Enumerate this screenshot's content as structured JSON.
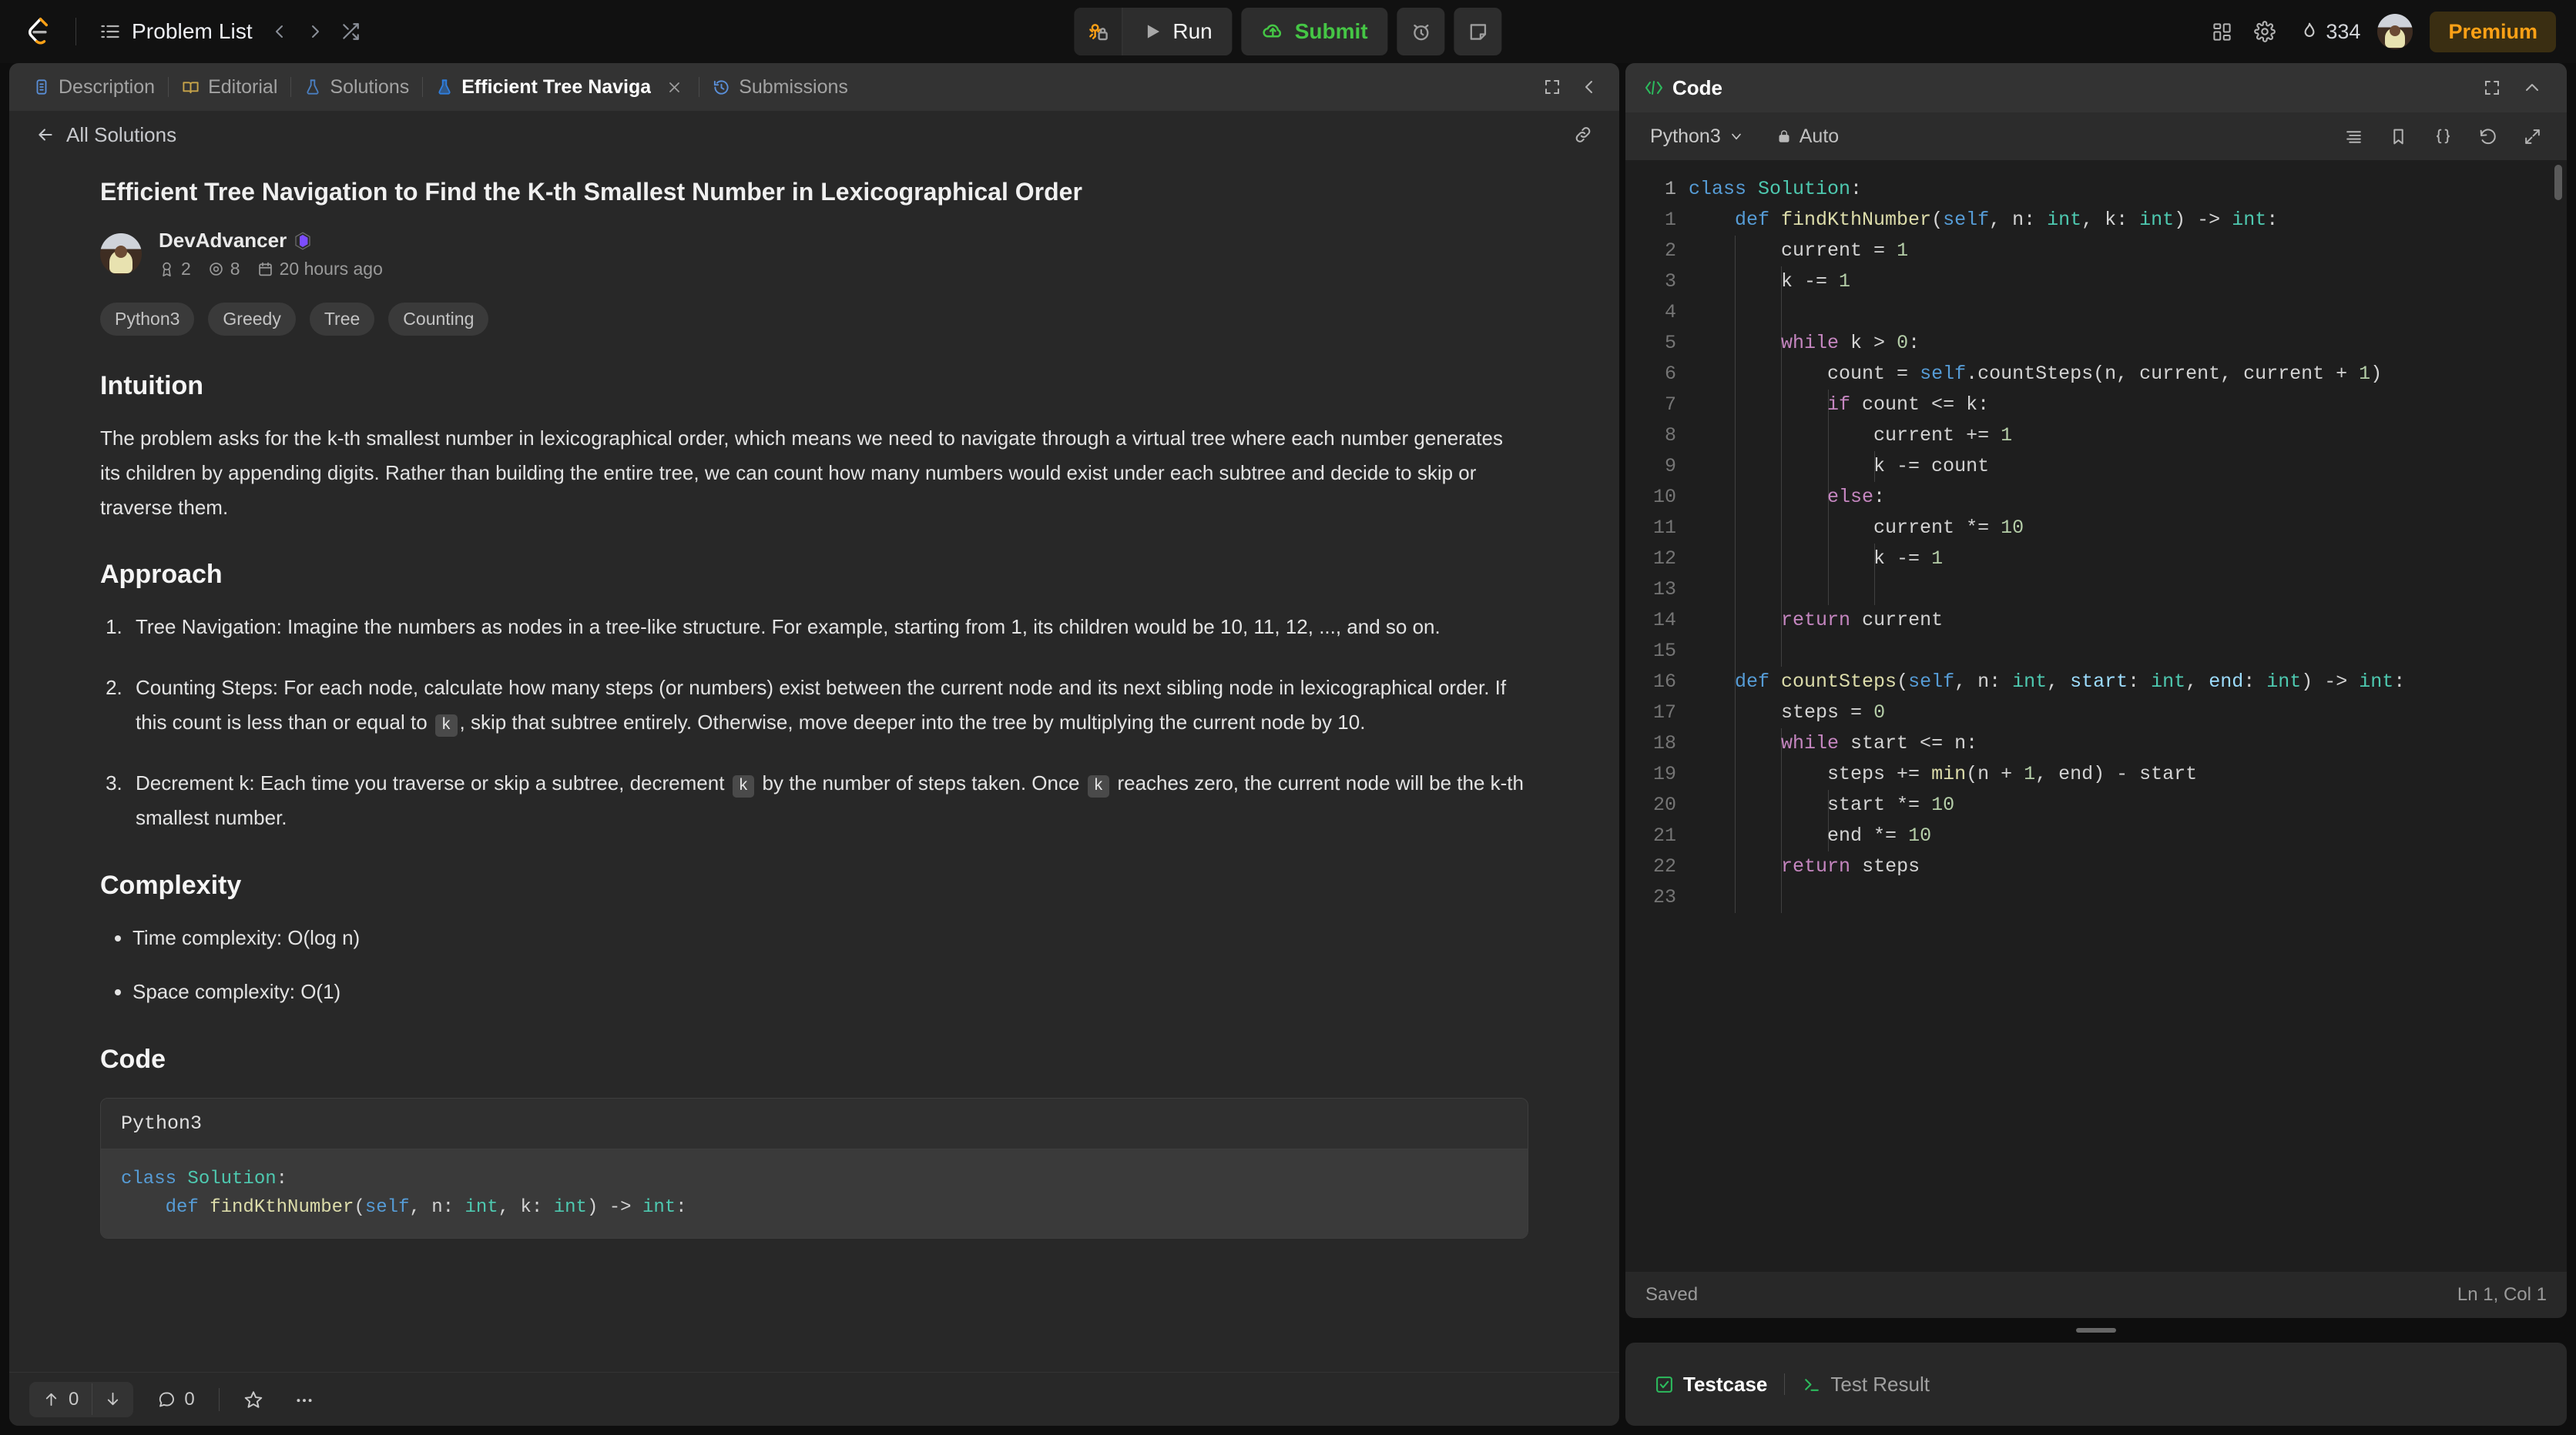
{
  "topnav": {
    "logo_icon": "leetcode-logo-icon",
    "problem_list_label": "Problem List",
    "prev_icon": "chevron-left-icon",
    "next_icon": "chevron-right-icon",
    "shuffle_icon": "shuffle-icon",
    "debug_icon": "debug-lock-icon",
    "run_label": "Run",
    "run_icon": "play-icon",
    "submit_label": "Submit",
    "submit_icon": "cloud-upload-icon",
    "timer_icon": "alarm-clock-icon",
    "note_icon": "sticky-note-icon",
    "apps_icon": "apps-grid-icon",
    "settings_icon": "gear-icon",
    "streak_icon": "flame-icon",
    "streak_count": "334",
    "avatar_icon": "user-avatar",
    "premium_label": "Premium",
    "premium_color": "#ffa116",
    "submit_color": "#45c645"
  },
  "left_panel": {
    "tabs": [
      {
        "label": "Description",
        "icon": "description-doc-icon",
        "active": false,
        "closable": false
      },
      {
        "label": "Editorial",
        "icon": "editorial-book-icon",
        "active": false,
        "closable": false
      },
      {
        "label": "Solutions",
        "icon": "solutions-flask-icon",
        "active": false,
        "closable": false
      },
      {
        "label": "Efficient Tree Naviga",
        "icon": "solution-flask-icon",
        "active": true,
        "closable": true
      },
      {
        "label": "Submissions",
        "icon": "submissions-history-icon",
        "active": false,
        "closable": false
      }
    ],
    "tab_close_icon": "close-icon",
    "expand_icon": "expand-fullscreen-icon",
    "collapse_icon": "chevron-left-icon",
    "breadcrumb": {
      "back_icon": "arrow-left-icon",
      "label": "All Solutions",
      "link_icon": "link-chain-icon"
    },
    "article": {
      "title": "Efficient Tree Navigation to Find the K-th Smallest Number in Lexicographical Order",
      "author": {
        "name": "DevAdvancer",
        "badge_icon": "purple-gem-badge-icon",
        "reputation_icon": "medal-icon",
        "reputation": "2",
        "views_icon": "eye-icon",
        "views": "8",
        "time_icon": "calendar-icon",
        "time": "20 hours ago"
      },
      "tags": [
        "Python3",
        "Greedy",
        "Tree",
        "Counting"
      ],
      "sections": {
        "intuition_heading": "Intuition",
        "intuition_body": "The problem asks for the k-th smallest number in lexicographical order, which means we need to navigate through a virtual tree where each number generates its children by appending digits. Rather than building the entire tree, we can count how many numbers would exist under each subtree and decide to skip or traverse them.",
        "approach_heading": "Approach",
        "approach_steps": [
          {
            "before": "Tree Navigation: Imagine the numbers as nodes in a tree-like structure. For example, starting from 1, its children would be 10, 11, 12, ..., and so on.",
            "code1": null,
            "mid": null,
            "code2": null,
            "after": null
          },
          {
            "before": "Counting Steps: For each node, calculate how many steps (or numbers) exist between the current node and its next sibling node in lexicographical order. If this count is less than or equal to ",
            "code1": "k",
            "mid": ", skip that subtree entirely. Otherwise, move deeper into the tree by multiplying the current node by 10.",
            "code2": null,
            "after": null
          },
          {
            "before": "Decrement k: Each time you traverse or skip a subtree, decrement ",
            "code1": "k",
            "mid": " by the number of steps taken. Once ",
            "code2": "k",
            "after": " reaches zero, the current node will be the k-th smallest number."
          }
        ],
        "complexity_heading": "Complexity",
        "complexity_items": [
          "Time complexity: O(log n)",
          "Space complexity: O(1)"
        ],
        "code_heading": "Code",
        "code_block_lang": "Python3",
        "code_block_lines": [
          {
            "tokens": [
              {
                "t": "class ",
                "c": "kw2"
              },
              {
                "t": "Solution",
                "c": "cls"
              },
              {
                "t": ":",
                "c": "plain"
              }
            ]
          },
          {
            "tokens": [
              {
                "t": "    def ",
                "c": "kw2"
              },
              {
                "t": "findKthNumber",
                "c": "fn"
              },
              {
                "t": "(",
                "c": "plain"
              },
              {
                "t": "self",
                "c": "kw2"
              },
              {
                "t": ", n: ",
                "c": "plain"
              },
              {
                "t": "int",
                "c": "type"
              },
              {
                "t": ", k: ",
                "c": "plain"
              },
              {
                "t": "int",
                "c": "type"
              },
              {
                "t": ") -> ",
                "c": "plain"
              },
              {
                "t": "int",
                "c": "type"
              },
              {
                "t": ":",
                "c": "plain"
              }
            ]
          }
        ]
      }
    },
    "footer": {
      "upvote_icon": "arrow-up-icon",
      "upvote_count": "0",
      "downvote_icon": "arrow-down-icon",
      "comment_icon": "comment-bubble-icon",
      "comment_count": "0",
      "star_icon": "star-icon",
      "more_icon": "ellipsis-icon"
    }
  },
  "right_panel": {
    "header": {
      "title": "Code",
      "code_icon": "code-brackets-icon",
      "expand_icon": "expand-fullscreen-icon",
      "collapse_icon": "chevron-up-icon"
    },
    "toolbar": {
      "language": "Python3",
      "language_chevron_icon": "chevron-down-icon",
      "lock_icon": "lock-icon",
      "auto_label": "Auto",
      "format_icon": "format-lines-icon",
      "bookmark_icon": "bookmark-icon",
      "braces_icon": "curly-braces-icon",
      "reset_icon": "reset-undo-icon",
      "fullscreen_icon": "expand-arrows-icon"
    },
    "editor": {
      "gutter_first": "1",
      "line_numbers": [
        "1",
        "2",
        "3",
        "4",
        "5",
        "6",
        "7",
        "8",
        "9",
        "10",
        "11",
        "12",
        "13",
        "14",
        "15",
        "16",
        "17",
        "18",
        "19",
        "20",
        "21",
        "22",
        "23"
      ],
      "lines": [
        {
          "indent": 0,
          "tokens": [
            {
              "t": "class ",
              "c": "kw2"
            },
            {
              "t": "Solution",
              "c": "cls"
            },
            {
              "t": ":",
              "c": "plain"
            }
          ]
        },
        {
          "indent": 1,
          "tokens": [
            {
              "t": "def ",
              "c": "kw2"
            },
            {
              "t": "findKthNumber",
              "c": "fn"
            },
            {
              "t": "(",
              "c": "plain"
            },
            {
              "t": "self",
              "c": "kw2"
            },
            {
              "t": ", n: ",
              "c": "plain"
            },
            {
              "t": "int",
              "c": "type"
            },
            {
              "t": ", k: ",
              "c": "plain"
            },
            {
              "t": "int",
              "c": "type"
            },
            {
              "t": ") -> ",
              "c": "plain"
            },
            {
              "t": "int",
              "c": "type"
            },
            {
              "t": ":",
              "c": "plain"
            }
          ]
        },
        {
          "indent": 2,
          "tokens": [
            {
              "t": "current = ",
              "c": "plain"
            },
            {
              "t": "1",
              "c": "num"
            }
          ]
        },
        {
          "indent": 2,
          "tokens": [
            {
              "t": "k -= ",
              "c": "plain"
            },
            {
              "t": "1",
              "c": "num"
            }
          ]
        },
        {
          "indent": 0,
          "tokens": []
        },
        {
          "indent": 2,
          "tokens": [
            {
              "t": "while ",
              "c": "kw"
            },
            {
              "t": "k > ",
              "c": "plain"
            },
            {
              "t": "0",
              "c": "num"
            },
            {
              "t": ":",
              "c": "plain"
            }
          ]
        },
        {
          "indent": 3,
          "tokens": [
            {
              "t": "count = ",
              "c": "plain"
            },
            {
              "t": "self",
              "c": "kw2"
            },
            {
              "t": ".countSteps(n, current, current + ",
              "c": "plain"
            },
            {
              "t": "1",
              "c": "num"
            },
            {
              "t": ")",
              "c": "plain"
            }
          ]
        },
        {
          "indent": 3,
          "tokens": [
            {
              "t": "if ",
              "c": "kw"
            },
            {
              "t": "count <= k:",
              "c": "plain"
            }
          ]
        },
        {
          "indent": 4,
          "tokens": [
            {
              "t": "current += ",
              "c": "plain"
            },
            {
              "t": "1",
              "c": "num"
            }
          ]
        },
        {
          "indent": 4,
          "tokens": [
            {
              "t": "k -= count",
              "c": "plain"
            }
          ]
        },
        {
          "indent": 3,
          "tokens": [
            {
              "t": "else",
              "c": "kw"
            },
            {
              "t": ":",
              "c": "plain"
            }
          ]
        },
        {
          "indent": 4,
          "tokens": [
            {
              "t": "current *= ",
              "c": "plain"
            },
            {
              "t": "10",
              "c": "num"
            }
          ]
        },
        {
          "indent": 4,
          "tokens": [
            {
              "t": "k -= ",
              "c": "plain"
            },
            {
              "t": "1",
              "c": "num"
            }
          ]
        },
        {
          "indent": 0,
          "tokens": []
        },
        {
          "indent": 2,
          "tokens": [
            {
              "t": "return ",
              "c": "kw"
            },
            {
              "t": "current",
              "c": "plain"
            }
          ]
        },
        {
          "indent": 0,
          "tokens": []
        },
        {
          "indent": 1,
          "tokens": [
            {
              "t": "def ",
              "c": "kw2"
            },
            {
              "t": "countSteps",
              "c": "fn"
            },
            {
              "t": "(",
              "c": "plain"
            },
            {
              "t": "self",
              "c": "kw2"
            },
            {
              "t": ", n: ",
              "c": "plain"
            },
            {
              "t": "int",
              "c": "type"
            },
            {
              "t": ", ",
              "c": "plain"
            },
            {
              "t": "start",
              "c": "param"
            },
            {
              "t": ": ",
              "c": "plain"
            },
            {
              "t": "int",
              "c": "type"
            },
            {
              "t": ", ",
              "c": "plain"
            },
            {
              "t": "end",
              "c": "param"
            },
            {
              "t": ": ",
              "c": "plain"
            },
            {
              "t": "int",
              "c": "type"
            },
            {
              "t": ") -> ",
              "c": "plain"
            },
            {
              "t": "int",
              "c": "type"
            },
            {
              "t": ":",
              "c": "plain"
            }
          ]
        },
        {
          "indent": 2,
          "tokens": [
            {
              "t": "steps = ",
              "c": "plain"
            },
            {
              "t": "0",
              "c": "num"
            }
          ]
        },
        {
          "indent": 2,
          "tokens": [
            {
              "t": "while ",
              "c": "kw"
            },
            {
              "t": "start <= n:",
              "c": "plain"
            }
          ]
        },
        {
          "indent": 3,
          "tokens": [
            {
              "t": "steps += ",
              "c": "plain"
            },
            {
              "t": "min",
              "c": "fn"
            },
            {
              "t": "(n + ",
              "c": "plain"
            },
            {
              "t": "1",
              "c": "num"
            },
            {
              "t": ", end) - start",
              "c": "plain"
            }
          ]
        },
        {
          "indent": 3,
          "tokens": [
            {
              "t": "start *= ",
              "c": "plain"
            },
            {
              "t": "10",
              "c": "num"
            }
          ]
        },
        {
          "indent": 3,
          "tokens": [
            {
              "t": "end *= ",
              "c": "plain"
            },
            {
              "t": "10",
              "c": "num"
            }
          ]
        },
        {
          "indent": 2,
          "tokens": [
            {
              "t": "return ",
              "c": "kw"
            },
            {
              "t": "steps",
              "c": "plain"
            }
          ]
        },
        {
          "indent": 0,
          "tokens": []
        }
      ]
    },
    "status": {
      "saved_label": "Saved",
      "cursor_label": "Ln 1, Col 1"
    },
    "testpanel": {
      "testcase_label": "Testcase",
      "testcase_icon": "checkbox-checked-icon",
      "test_result_label": "Test Result",
      "test_result_icon": "terminal-prompt-icon"
    }
  }
}
